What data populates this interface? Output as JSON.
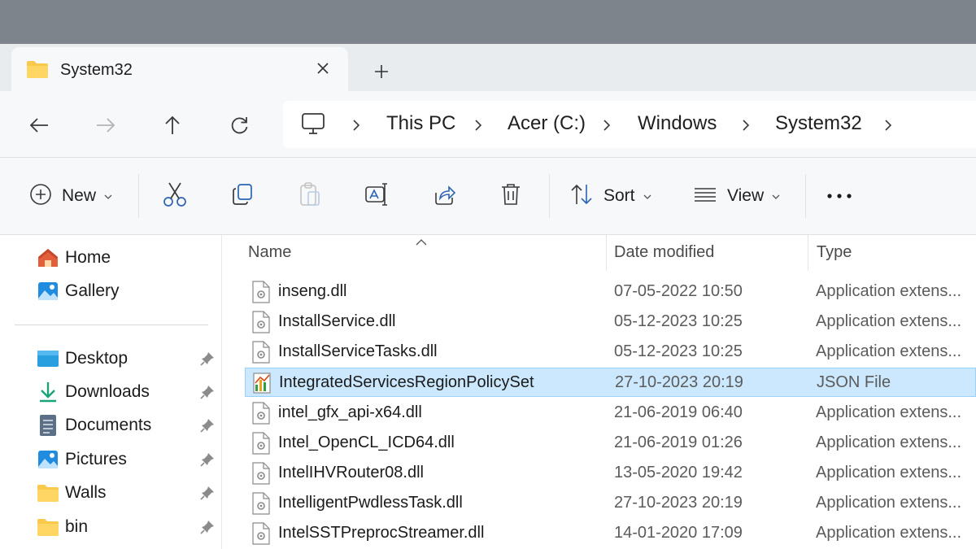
{
  "tab": {
    "title": "System32"
  },
  "breadcrumb": [
    "This PC",
    "Acer (C:)",
    "Windows",
    "System32"
  ],
  "commands": {
    "new_label": "New",
    "sort_label": "Sort",
    "view_label": "View"
  },
  "sidebar": {
    "items": [
      {
        "label": "Home",
        "icon": "home-icon"
      },
      {
        "label": "Gallery",
        "icon": "gallery-icon"
      },
      {
        "label": "Desktop",
        "icon": "desktop-icon",
        "pinned": true
      },
      {
        "label": "Downloads",
        "icon": "downloads-icon",
        "pinned": true
      },
      {
        "label": "Documents",
        "icon": "documents-icon",
        "pinned": true
      },
      {
        "label": "Pictures",
        "icon": "pictures-icon",
        "pinned": true
      },
      {
        "label": "Walls",
        "icon": "folder-icon",
        "pinned": true
      },
      {
        "label": "bin",
        "icon": "folder-icon",
        "pinned": true
      }
    ]
  },
  "columns": {
    "name": "Name",
    "date": "Date modified",
    "type": "Type"
  },
  "files": [
    {
      "name": "inseng.dll",
      "date": "07-05-2022 10:50",
      "type": "Application extens...",
      "icon": "dll-file-icon"
    },
    {
      "name": "InstallService.dll",
      "date": "05-12-2023 10:25",
      "type": "Application extens...",
      "icon": "dll-file-icon"
    },
    {
      "name": "InstallServiceTasks.dll",
      "date": "05-12-2023 10:25",
      "type": "Application extens...",
      "icon": "dll-file-icon"
    },
    {
      "name": "IntegratedServicesRegionPolicySet",
      "date": "27-10-2023 20:19",
      "type": "JSON File",
      "icon": "json-file-icon",
      "selected": true
    },
    {
      "name": "intel_gfx_api-x64.dll",
      "date": "21-06-2019 06:40",
      "type": "Application extens...",
      "icon": "dll-file-icon"
    },
    {
      "name": "Intel_OpenCL_ICD64.dll",
      "date": "21-06-2019 01:26",
      "type": "Application extens...",
      "icon": "dll-file-icon"
    },
    {
      "name": "IntelIHVRouter08.dll",
      "date": "13-05-2020 19:42",
      "type": "Application extens...",
      "icon": "dll-file-icon"
    },
    {
      "name": "IntelligentPwdlessTask.dll",
      "date": "27-10-2023 20:19",
      "type": "Application extens...",
      "icon": "dll-file-icon"
    },
    {
      "name": "IntelSSTPreprocStreamer.dll",
      "date": "14-01-2020 17:09",
      "type": "Application extens...",
      "icon": "dll-file-icon"
    }
  ],
  "colors": {
    "selection_bg": "#cce8ff",
    "selection_border": "#99d1ff",
    "accent": "#0067c0"
  }
}
